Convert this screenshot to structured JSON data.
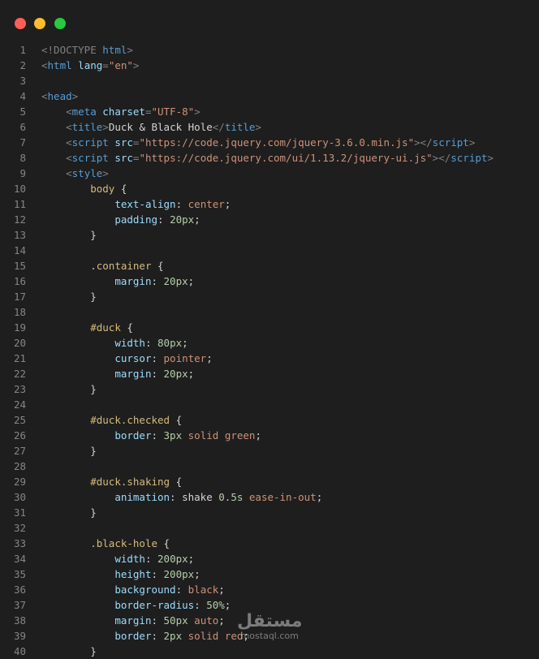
{
  "window": {
    "controls": [
      "close",
      "minimize",
      "maximize"
    ],
    "colors": {
      "close": "#ff5f57",
      "minimize": "#febc2e",
      "maximize": "#28c840",
      "background": "#1e1e1e"
    }
  },
  "code_lines": [
    {
      "n": "1",
      "tokens": [
        [
          "punc",
          "<!DOCTYPE "
        ],
        [
          "tag",
          "html"
        ],
        [
          "punc",
          ">"
        ]
      ]
    },
    {
      "n": "2",
      "tokens": [
        [
          "punc",
          "<"
        ],
        [
          "tag",
          "html "
        ],
        [
          "attr",
          "lang"
        ],
        [
          "punc",
          "="
        ],
        [
          "str",
          "\"en\""
        ],
        [
          "punc",
          ">"
        ]
      ]
    },
    {
      "n": "3",
      "tokens": []
    },
    {
      "n": "4",
      "tokens": [
        [
          "punc",
          "<"
        ],
        [
          "tag",
          "head"
        ],
        [
          "punc",
          ">"
        ]
      ]
    },
    {
      "n": "5",
      "tokens": [
        [
          "text",
          "    "
        ],
        [
          "punc",
          "<"
        ],
        [
          "tag",
          "meta "
        ],
        [
          "attr",
          "charset"
        ],
        [
          "punc",
          "="
        ],
        [
          "str",
          "\"UTF-8\""
        ],
        [
          "punc",
          ">"
        ]
      ]
    },
    {
      "n": "6",
      "tokens": [
        [
          "text",
          "    "
        ],
        [
          "punc",
          "<"
        ],
        [
          "tag",
          "title"
        ],
        [
          "punc",
          ">"
        ],
        [
          "text",
          "Duck & Black Hole"
        ],
        [
          "punc",
          "</"
        ],
        [
          "tag",
          "title"
        ],
        [
          "punc",
          ">"
        ]
      ]
    },
    {
      "n": "7",
      "tokens": [
        [
          "text",
          "    "
        ],
        [
          "punc",
          "<"
        ],
        [
          "tag",
          "script "
        ],
        [
          "attr",
          "src"
        ],
        [
          "punc",
          "="
        ],
        [
          "str",
          "\"https://code.jquery.com/jquery-3.6.0.min.js\""
        ],
        [
          "punc",
          "></"
        ],
        [
          "tag",
          "script"
        ],
        [
          "punc",
          ">"
        ]
      ]
    },
    {
      "n": "8",
      "tokens": [
        [
          "text",
          "    "
        ],
        [
          "punc",
          "<"
        ],
        [
          "tag",
          "script "
        ],
        [
          "attr",
          "src"
        ],
        [
          "punc",
          "="
        ],
        [
          "str",
          "\"https://code.jquery.com/ui/1.13.2/jquery-ui.js\""
        ],
        [
          "punc",
          "></"
        ],
        [
          "tag",
          "script"
        ],
        [
          "punc",
          ">"
        ]
      ]
    },
    {
      "n": "9",
      "tokens": [
        [
          "text",
          "    "
        ],
        [
          "punc",
          "<"
        ],
        [
          "tag",
          "style"
        ],
        [
          "punc",
          ">"
        ]
      ]
    },
    {
      "n": "10",
      "tokens": [
        [
          "text",
          "        "
        ],
        [
          "sel",
          "body"
        ],
        [
          "plain",
          " {"
        ]
      ]
    },
    {
      "n": "11",
      "tokens": [
        [
          "text",
          "            "
        ],
        [
          "prop",
          "text-align"
        ],
        [
          "plain",
          ": "
        ],
        [
          "kw",
          "center"
        ],
        [
          "plain",
          ";"
        ]
      ]
    },
    {
      "n": "12",
      "tokens": [
        [
          "text",
          "            "
        ],
        [
          "prop",
          "padding"
        ],
        [
          "plain",
          ": "
        ],
        [
          "num",
          "20px"
        ],
        [
          "plain",
          ";"
        ]
      ]
    },
    {
      "n": "13",
      "tokens": [
        [
          "text",
          "        "
        ],
        [
          "plain",
          "}"
        ]
      ]
    },
    {
      "n": "14",
      "tokens": []
    },
    {
      "n": "15",
      "tokens": [
        [
          "text",
          "        "
        ],
        [
          "sel",
          ".container"
        ],
        [
          "plain",
          " {"
        ]
      ]
    },
    {
      "n": "16",
      "tokens": [
        [
          "text",
          "            "
        ],
        [
          "prop",
          "margin"
        ],
        [
          "plain",
          ": "
        ],
        [
          "num",
          "20px"
        ],
        [
          "plain",
          ";"
        ]
      ]
    },
    {
      "n": "17",
      "tokens": [
        [
          "text",
          "        "
        ],
        [
          "plain",
          "}"
        ]
      ]
    },
    {
      "n": "18",
      "tokens": []
    },
    {
      "n": "19",
      "tokens": [
        [
          "text",
          "        "
        ],
        [
          "sel",
          "#duck"
        ],
        [
          "plain",
          " {"
        ]
      ]
    },
    {
      "n": "20",
      "tokens": [
        [
          "text",
          "            "
        ],
        [
          "prop",
          "width"
        ],
        [
          "plain",
          ": "
        ],
        [
          "num",
          "80px"
        ],
        [
          "plain",
          ";"
        ]
      ]
    },
    {
      "n": "21",
      "tokens": [
        [
          "text",
          "            "
        ],
        [
          "prop",
          "cursor"
        ],
        [
          "plain",
          ": "
        ],
        [
          "kw",
          "pointer"
        ],
        [
          "plain",
          ";"
        ]
      ]
    },
    {
      "n": "22",
      "tokens": [
        [
          "text",
          "            "
        ],
        [
          "prop",
          "margin"
        ],
        [
          "plain",
          ": "
        ],
        [
          "num",
          "20px"
        ],
        [
          "plain",
          ";"
        ]
      ]
    },
    {
      "n": "23",
      "tokens": [
        [
          "text",
          "        "
        ],
        [
          "plain",
          "}"
        ]
      ]
    },
    {
      "n": "24",
      "tokens": []
    },
    {
      "n": "25",
      "tokens": [
        [
          "text",
          "        "
        ],
        [
          "sel",
          "#duck.checked"
        ],
        [
          "plain",
          " {"
        ]
      ]
    },
    {
      "n": "26",
      "tokens": [
        [
          "text",
          "            "
        ],
        [
          "prop",
          "border"
        ],
        [
          "plain",
          ": "
        ],
        [
          "num",
          "3px"
        ],
        [
          "plain",
          " "
        ],
        [
          "kw",
          "solid"
        ],
        [
          "plain",
          " "
        ],
        [
          "kw",
          "green"
        ],
        [
          "plain",
          ";"
        ]
      ]
    },
    {
      "n": "27",
      "tokens": [
        [
          "text",
          "        "
        ],
        [
          "plain",
          "}"
        ]
      ]
    },
    {
      "n": "28",
      "tokens": []
    },
    {
      "n": "29",
      "tokens": [
        [
          "text",
          "        "
        ],
        [
          "sel",
          "#duck.shaking"
        ],
        [
          "plain",
          " {"
        ]
      ]
    },
    {
      "n": "30",
      "tokens": [
        [
          "text",
          "            "
        ],
        [
          "prop",
          "animation"
        ],
        [
          "plain",
          ": shake "
        ],
        [
          "num",
          "0.5s"
        ],
        [
          "plain",
          " "
        ],
        [
          "kw",
          "ease-in-out"
        ],
        [
          "plain",
          ";"
        ]
      ]
    },
    {
      "n": "31",
      "tokens": [
        [
          "text",
          "        "
        ],
        [
          "plain",
          "}"
        ]
      ]
    },
    {
      "n": "32",
      "tokens": []
    },
    {
      "n": "33",
      "tokens": [
        [
          "text",
          "        "
        ],
        [
          "sel",
          ".black-hole"
        ],
        [
          "plain",
          " {"
        ]
      ]
    },
    {
      "n": "34",
      "tokens": [
        [
          "text",
          "            "
        ],
        [
          "prop",
          "width"
        ],
        [
          "plain",
          ": "
        ],
        [
          "num",
          "200px"
        ],
        [
          "plain",
          ";"
        ]
      ]
    },
    {
      "n": "35",
      "tokens": [
        [
          "text",
          "            "
        ],
        [
          "prop",
          "height"
        ],
        [
          "plain",
          ": "
        ],
        [
          "num",
          "200px"
        ],
        [
          "plain",
          ";"
        ]
      ]
    },
    {
      "n": "36",
      "tokens": [
        [
          "text",
          "            "
        ],
        [
          "prop",
          "background"
        ],
        [
          "plain",
          ": "
        ],
        [
          "kw",
          "black"
        ],
        [
          "plain",
          ";"
        ]
      ]
    },
    {
      "n": "37",
      "tokens": [
        [
          "text",
          "            "
        ],
        [
          "prop",
          "border-radius"
        ],
        [
          "plain",
          ": "
        ],
        [
          "num",
          "50%"
        ],
        [
          "plain",
          ";"
        ]
      ]
    },
    {
      "n": "38",
      "tokens": [
        [
          "text",
          "            "
        ],
        [
          "prop",
          "margin"
        ],
        [
          "plain",
          ": "
        ],
        [
          "num",
          "50px"
        ],
        [
          "plain",
          " "
        ],
        [
          "kw",
          "auto"
        ],
        [
          "plain",
          ";"
        ]
      ]
    },
    {
      "n": "39",
      "tokens": [
        [
          "text",
          "            "
        ],
        [
          "prop",
          "border"
        ],
        [
          "plain",
          ": "
        ],
        [
          "num",
          "2px"
        ],
        [
          "plain",
          " "
        ],
        [
          "kw",
          "solid"
        ],
        [
          "plain",
          " "
        ],
        [
          "kw",
          "red"
        ],
        [
          "plain",
          ";"
        ]
      ]
    },
    {
      "n": "40",
      "tokens": [
        [
          "text",
          "        "
        ],
        [
          "plain",
          "}"
        ]
      ]
    }
  ],
  "watermark": {
    "arabic": "مستقل",
    "latin": "mostaql.com"
  }
}
